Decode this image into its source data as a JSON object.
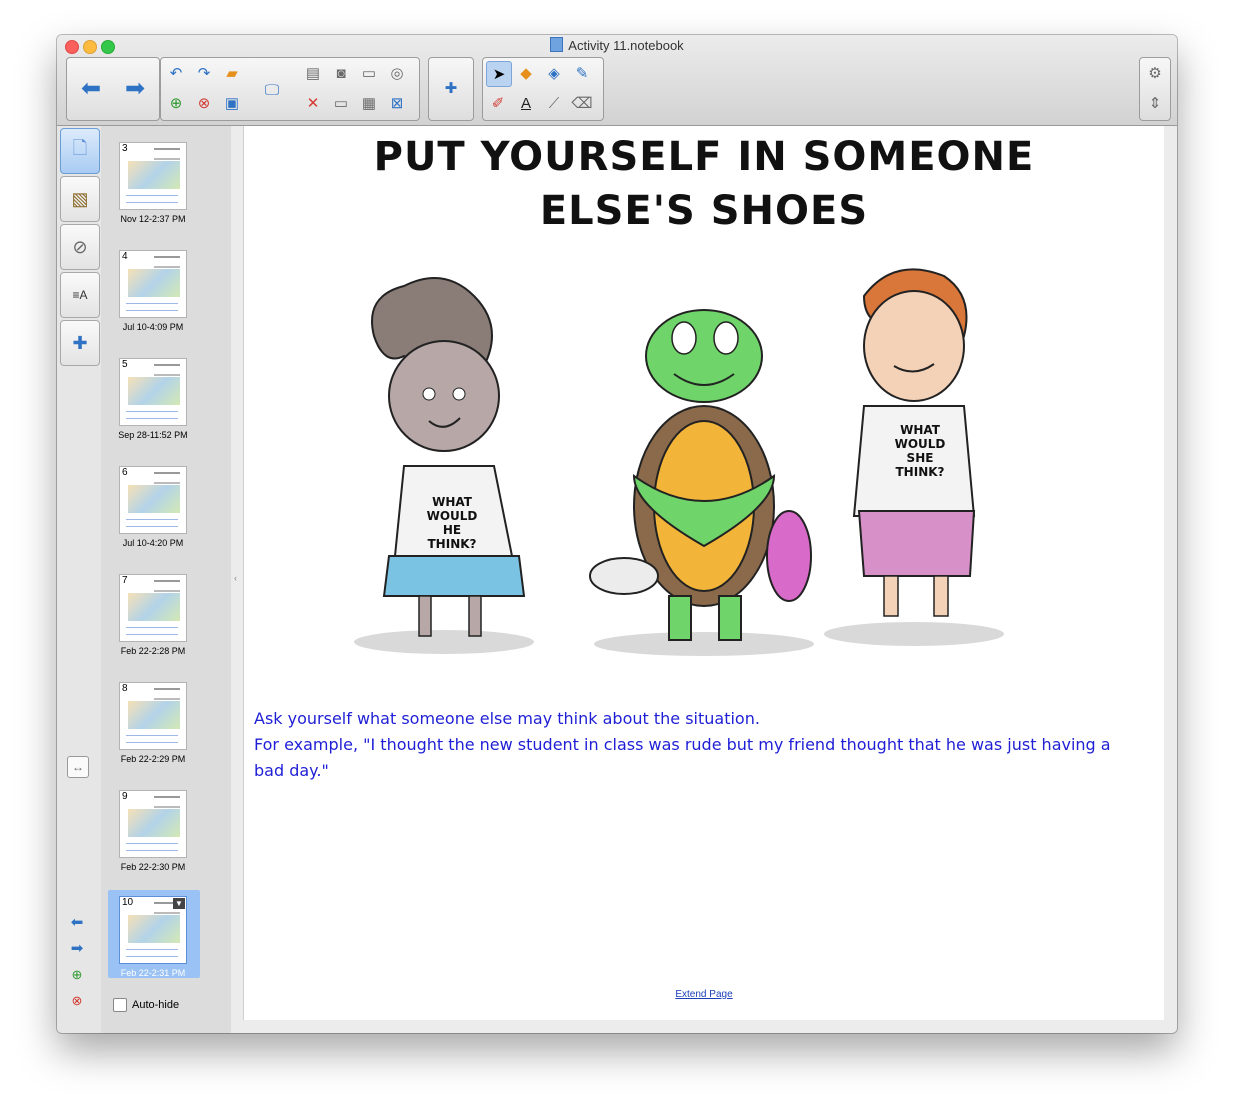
{
  "window": {
    "title": "Activity 11.notebook"
  },
  "toolbar": {
    "back_icon": "arrow-left-icon",
    "forward_icon": "arrow-right-icon",
    "settings_icon": "gear-icon",
    "resize_icon": "up-down-arrow-icon"
  },
  "side_tabs": [
    "page-sorter-icon",
    "gallery-icon",
    "attachments-icon",
    "properties-icon",
    "addons-icon"
  ],
  "sorter": {
    "pages": [
      {
        "num": "3",
        "date": "Nov 12-2:37 PM"
      },
      {
        "num": "4",
        "date": "Jul 10-4:09 PM"
      },
      {
        "num": "5",
        "date": "Sep 28-11:52 PM"
      },
      {
        "num": "6",
        "date": "Jul 10-4:20 PM"
      },
      {
        "num": "7",
        "date": "Feb 22-2:28 PM"
      },
      {
        "num": "8",
        "date": "Feb 22-2:29 PM"
      },
      {
        "num": "9",
        "date": "Feb 22-2:30 PM"
      },
      {
        "num": "10",
        "date": "Feb 22-2:31 PM"
      }
    ],
    "autohide_label": "Auto-hide"
  },
  "page": {
    "headline_line1": "PUT YOURSELF IN SOMEONE",
    "headline_line2": "ELSE'S SHOES",
    "shirt_girl": "WHAT WOULD HE THINK?",
    "shirt_boy": "WHAT WOULD SHE THINK?",
    "text_line1": "Ask yourself what someone else may think about the situation.",
    "text_line2": "For example, \"I thought the new student in class was rude but my friend thought that he was just having a bad day.\"",
    "extend_link": "Extend Page"
  }
}
